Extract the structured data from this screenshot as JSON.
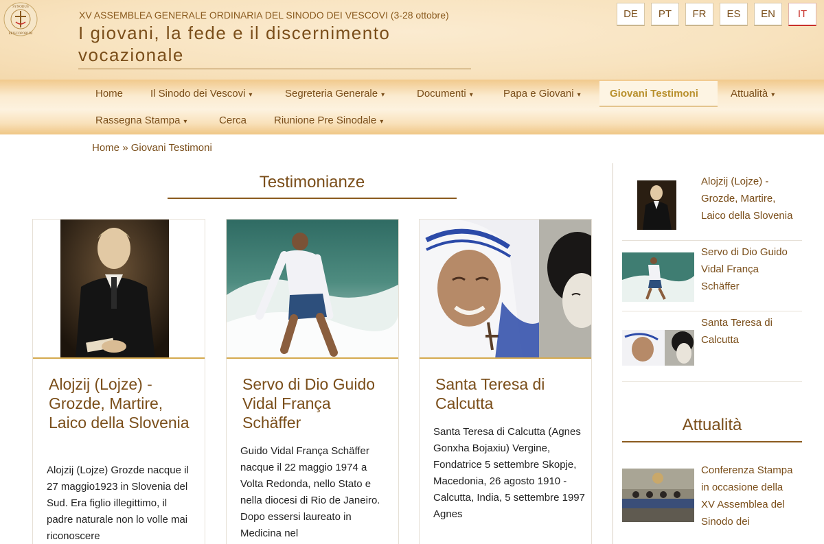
{
  "header": {
    "event": "XV ASSEMBLEA GENERALE ORDINARIA DEL SINODO DEI VESCOVI (3-28 ottobre)",
    "title": "I giovani, la fede e il discernimento vocazionale",
    "logo_icon": "synodus-episcoporum-seal",
    "logo_text": "SYNODUS EPISCOPORUM"
  },
  "languages": [
    "DE",
    "PT",
    "FR",
    "ES",
    "EN",
    "IT"
  ],
  "active_language": "IT",
  "nav": {
    "items": [
      {
        "label": "Home",
        "dropdown": false
      },
      {
        "label": "Il Sinodo dei Vescovi",
        "dropdown": true
      },
      {
        "label": "Segreteria Generale",
        "dropdown": true
      },
      {
        "label": "Documenti",
        "dropdown": true
      },
      {
        "label": "Papa e Giovani",
        "dropdown": true
      },
      {
        "label": "Giovani Testimoni",
        "dropdown": false,
        "active": true
      },
      {
        "label": "Attualità",
        "dropdown": true
      },
      {
        "label": "Rassegna Stampa",
        "dropdown": true
      },
      {
        "label": "Cerca",
        "dropdown": false
      },
      {
        "label": "Riunione Pre Sinodale",
        "dropdown": true
      }
    ]
  },
  "breadcrumb": {
    "home": "Home",
    "separator": "»",
    "current": "Giovani Testimoni"
  },
  "main": {
    "section_title": "Testimonianze",
    "cards": [
      {
        "title": "Alojzij (Lojze) - Grozde, Martire, Laico della Slovenia",
        "text": "Alojzij (Lojze) Grozde nacque il 27 maggio1923 in Slovenia del Sud. Era figlio illegittimo, il padre naturale non lo volle mai riconoscere",
        "image": "portrait-painting-young-man"
      },
      {
        "title": "Servo di Dio Guido Vidal França Schäffer",
        "text": "Guido Vidal França Schäffer nacque il 22 maggio 1974 a Volta Redonda, nello Stato e nella diocesi di Rio de Janeiro. Dopo essersi laureato in Medicina nel",
        "image": "surfer-photo"
      },
      {
        "title": "Santa Teresa di Calcutta",
        "text": "Santa Teresa di Calcutta (Agnes Gonxha Bojaxiu) Vergine, Fondatrice 5 settembre Skopje, Macedonia, 26 agosto 1910 - Calcutta, India, 5 settembre 1997   Agnes",
        "image": "nun-and-young-woman-photos"
      }
    ]
  },
  "sidebar": {
    "items": [
      {
        "title": "Alojzij (Lojze) - Grozde, Martire, Laico della Slovenia"
      },
      {
        "title": "Servo di Dio Guido Vidal França Schäffer"
      },
      {
        "title": "Santa Teresa di Calcutta"
      }
    ],
    "news_heading": "Attualità",
    "news": [
      {
        "title": "Conferenza Stampa in occasione della XV Assemblea del Sinodo dei",
        "image": "press-conference-photo"
      }
    ]
  },
  "colors": {
    "brown": "#7a4e1a",
    "gold": "#b8902d",
    "active_lang": "#c8302a",
    "header_bg": "#f8e3bf"
  }
}
